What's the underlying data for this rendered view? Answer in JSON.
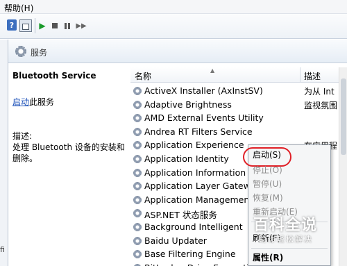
{
  "menubar": {
    "help_label": "帮助(H)"
  },
  "toolbar": {
    "help_glyph": "?",
    "play_glyph": "▶",
    "restart_glyph": "▶▶"
  },
  "left_strip": {
    "fragment": "fi"
  },
  "pane": {
    "title": "服务"
  },
  "details": {
    "service_name": "Bluetooth Service",
    "start_link": "启动",
    "start_suffix": "此服务",
    "description_label": "描述:",
    "description_text": "处理 Bluetooth 设备的安装和删除。"
  },
  "list": {
    "col_name": "名称",
    "col_desc": "描述",
    "sort_glyph": "▲",
    "rows": [
      {
        "name": "ActiveX Installer (AxInstSV)",
        "desc": "为从 Int"
      },
      {
        "name": "Adaptive Brightness",
        "desc": "监视氛围"
      },
      {
        "name": "AMD External Events Utility",
        "desc": ""
      },
      {
        "name": "Andrea RT Filters Service",
        "desc": ""
      },
      {
        "name": "Application Experience",
        "desc": "在应用程"
      },
      {
        "name": "Application Identity",
        "desc": ""
      },
      {
        "name": "Application Information",
        "desc": ""
      },
      {
        "name": "Application Layer Gateway",
        "desc": ""
      },
      {
        "name": "Application Management",
        "desc": ""
      },
      {
        "name": "ASP.NET 状态服务",
        "desc": ""
      },
      {
        "name": "Background Intelligent",
        "desc": ""
      },
      {
        "name": "Baidu Updater",
        "desc": ""
      },
      {
        "name": "Base Filtering Engine",
        "desc": ""
      },
      {
        "name": "BitLocker Drive Encryption",
        "desc": ""
      }
    ]
  },
  "context_menu": {
    "start": "启动(S)",
    "stop": "停止(O)",
    "pause": "暂停(U)",
    "resume": "恢复(M)",
    "restart": "重新启动(E)",
    "refresh": "刷新(F)",
    "properties": "属性(R)"
  },
  "watermark": {
    "title": "百科全说",
    "subtitle": "助你轻松解决"
  },
  "colors": {
    "highlight_ring": "#e01f26",
    "link": "#1a4fb8",
    "play_green": "#1a9a2b"
  }
}
